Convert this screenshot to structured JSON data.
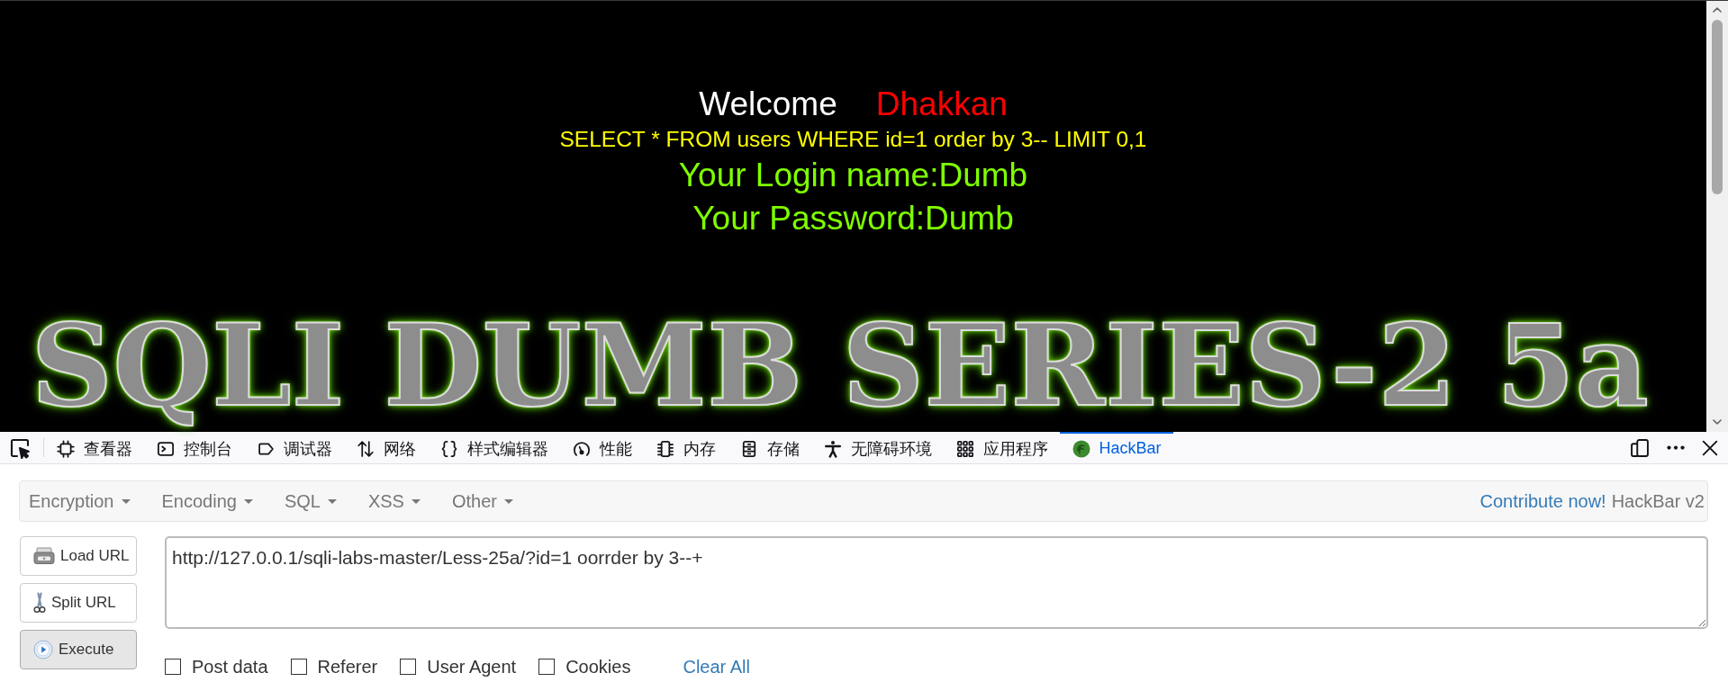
{
  "page": {
    "welcome": "Welcome",
    "user": "Dhakkan",
    "query": "SELECT * FROM users WHERE id=1 order by 3-- LIMIT 0,1",
    "login": "Your Login name:Dumb",
    "password": "Your Password:Dumb",
    "banner": "SQLI DUMB SERIES-2 5a"
  },
  "devtools": {
    "tabs": [
      {
        "label": "查看器",
        "selected": false
      },
      {
        "label": "控制台",
        "selected": false
      },
      {
        "label": "调试器",
        "selected": false
      },
      {
        "label": "网络",
        "selected": false
      },
      {
        "label": "样式编辑器",
        "selected": false
      },
      {
        "label": "性能",
        "selected": false
      },
      {
        "label": "内存",
        "selected": false
      },
      {
        "label": "存储",
        "selected": false
      },
      {
        "label": "无障碍环境",
        "selected": false
      },
      {
        "label": "应用程序",
        "selected": false
      },
      {
        "label": "HackBar",
        "selected": true
      }
    ]
  },
  "hackbar": {
    "menus": [
      "Encryption",
      "Encoding",
      "SQL",
      "XSS",
      "Other"
    ],
    "contribute_link": "Contribute now!",
    "version": "HackBar v2",
    "buttons": [
      {
        "label": "Load URL",
        "pressed": false
      },
      {
        "label": "Split URL",
        "pressed": false
      },
      {
        "label": "Execute",
        "pressed": true
      }
    ],
    "url": "http://127.0.0.1/sqli-labs-master/Less-25a/?id=1 oorrder by 3--+",
    "options": [
      {
        "label": "Post data",
        "checked": false
      },
      {
        "label": "Referer",
        "checked": false
      },
      {
        "label": "User Agent",
        "checked": false
      },
      {
        "label": "Cookies",
        "checked": false
      }
    ],
    "clear_all": "Clear All"
  }
}
